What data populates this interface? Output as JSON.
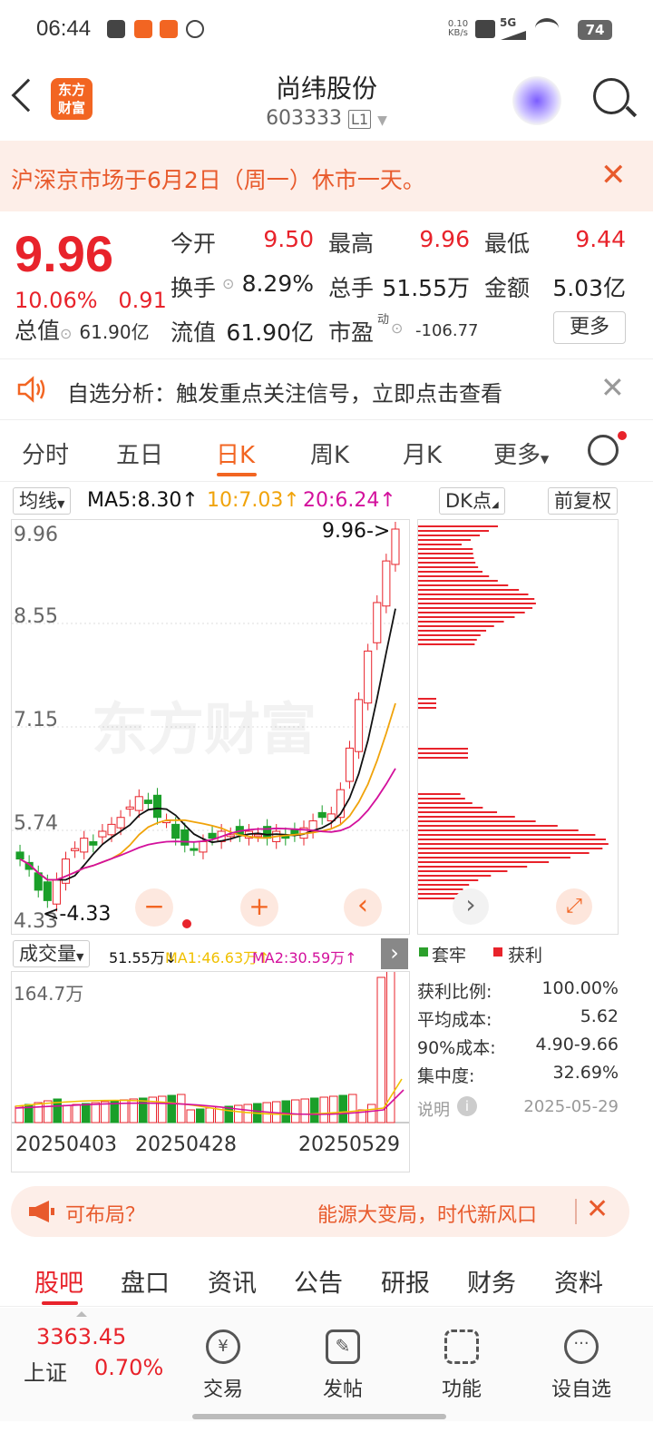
{
  "status": {
    "time": "06:44",
    "net": "0.10 KB/s",
    "signal": "5G",
    "battery": "74"
  },
  "header": {
    "logo_line1": "东方",
    "logo_line2": "财富",
    "title": "尚纬股份",
    "code": "603333",
    "level": "L1"
  },
  "notice": {
    "text": "沪深京市场于6月2日（周一）休市一天。",
    "close": "✕"
  },
  "quote": {
    "price": "9.96",
    "pct": "10.06%",
    "change": "0.91",
    "open_label": "今开",
    "open": "9.50",
    "high_label": "最高",
    "high": "9.96",
    "low_label": "最低",
    "low": "9.44",
    "turnover_label": "换手",
    "turnover": "8.29%",
    "volume_label": "总手",
    "volume": "51.55万",
    "amount_label": "金额",
    "amount": "5.03亿",
    "mcap_label": "总值",
    "mcap": "61.90亿",
    "float_label": "流值",
    "float": "61.90亿",
    "pe_label": "市盈",
    "pe_sup": "动",
    "pe": "-106.77",
    "more": "更多"
  },
  "signal": {
    "text": "自选分析：触发重点关注信号，立即点击查看",
    "close": "✕"
  },
  "tabs": {
    "items": [
      "分时",
      "五日",
      "日K",
      "周K",
      "月K",
      "更多"
    ],
    "active": 2
  },
  "ma": {
    "selector": "均线",
    "ma5": "MA5:8.30↑",
    "ma10": "10:7.03↑",
    "ma20": "20:6.24↑",
    "dk": "DK点",
    "fq": "前复权",
    "colors": {
      "ma5": "#111111",
      "ma10": "#f0a30a",
      "ma20": "#d3109c"
    }
  },
  "kline": {
    "y_ticks": [
      "9.96",
      "8.55",
      "7.15",
      "5.74",
      "4.33"
    ],
    "high_marker": "9.96->",
    "low_marker": "<-4.33",
    "watermark": "东方财富",
    "zoom_out": "−",
    "zoom_in": "+",
    "prev": "‹"
  },
  "chip": {
    "next": "›",
    "expand": "⤢",
    "legend_trapped": "套牢",
    "legend_profit": "获利",
    "stats": [
      {
        "label": "获利比例:",
        "value": "100.00%"
      },
      {
        "label": "平均成本:",
        "value": "5.62"
      },
      {
        "label": "90%成本:",
        "value": "4.90-9.66"
      },
      {
        "label": "集中度:",
        "value": "32.69%"
      }
    ],
    "note_label": "说明",
    "date": "2025-05-29"
  },
  "volume": {
    "selector": "成交量",
    "vol": "51.55万↓",
    "ma1": "MA1:46.63万↑",
    "ma2": "MA2:30.59万↑",
    "max_label": "164.7万",
    "dates": [
      "20250403",
      "20250428",
      "20250529"
    ]
  },
  "promo": {
    "left": "可布局？",
    "right": "能源大变局，时代新风口",
    "close": "✕"
  },
  "bottom_tabs": {
    "items": [
      "股吧",
      "盘口",
      "资讯",
      "公告",
      "研报",
      "财务",
      "资料"
    ],
    "active": 0
  },
  "index": {
    "value": "3363.45",
    "name": "上证",
    "pct": "0.70%"
  },
  "nav": {
    "items": [
      "交易",
      "发帖",
      "功能",
      "设自选"
    ]
  }
}
